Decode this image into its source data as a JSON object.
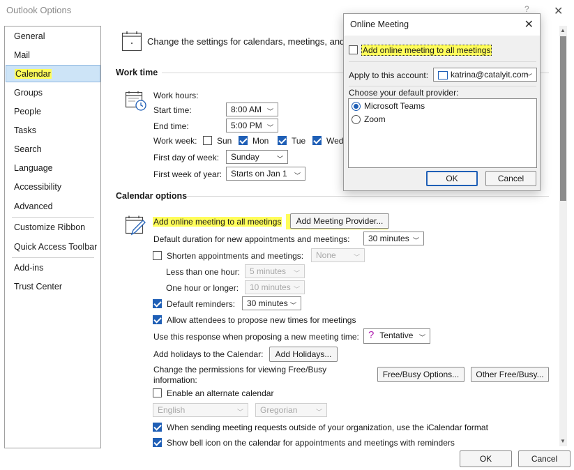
{
  "window": {
    "title": "Outlook Options",
    "help": "?",
    "close": "✕"
  },
  "sidebar": {
    "items": [
      {
        "label": "General"
      },
      {
        "label": "Mail"
      },
      {
        "label": "Calendar"
      },
      {
        "label": "Groups"
      },
      {
        "label": "People"
      },
      {
        "label": "Tasks"
      },
      {
        "label": "Search"
      },
      {
        "label": "Language"
      },
      {
        "label": "Accessibility"
      },
      {
        "label": "Advanced"
      },
      {
        "label": "Customize Ribbon"
      },
      {
        "label": "Quick Access Toolbar"
      },
      {
        "label": "Add-ins"
      },
      {
        "label": "Trust Center"
      }
    ],
    "selected": "Calendar"
  },
  "main": {
    "heading": "Change the settings for calendars, meetings, and",
    "work_time": {
      "title": "Work time",
      "hours_label": "Work hours:",
      "start_label": "Start time:",
      "start_value": "8:00 AM",
      "end_label": "End time:",
      "end_value": "5:00 PM",
      "week_label": "Work week:",
      "days": [
        {
          "label": "Sun",
          "checked": false
        },
        {
          "label": "Mon",
          "checked": true
        },
        {
          "label": "Tue",
          "checked": true
        },
        {
          "label": "Wed",
          "checked": true
        }
      ],
      "first_day_label": "First day of week:",
      "first_day_value": "Sunday",
      "first_week_label": "First week of year:",
      "first_week_value": "Starts on Jan 1"
    },
    "calendar_options": {
      "title": "Calendar options",
      "add_online_label": "Add online meeting to all meetings",
      "add_provider_button": "Add Meeting Provider...",
      "default_duration_label": "Default duration for new appointments and meetings:",
      "default_duration_value": "30 minutes",
      "shorten_label": "Shorten appointments and meetings:",
      "shorten_value": "None",
      "less_hour_label": "Less than one hour:",
      "less_hour_value": "5 minutes",
      "one_hour_label": "One hour or longer:",
      "one_hour_value": "10 minutes",
      "reminders_label": "Default reminders:",
      "reminders_value": "30 minutes",
      "propose_label": "Allow attendees to propose new times for meetings",
      "response_label": "Use this response when proposing a new meeting time:",
      "response_value": "Tentative",
      "holidays_label": "Add holidays to the Calendar:",
      "holidays_button": "Add Holidays...",
      "permissions_label_1": "Change the permissions for viewing Free/Busy",
      "permissions_label_2": "information:",
      "freebusy_button": "Free/Busy Options...",
      "other_freebusy_button": "Other Free/Busy...",
      "alternate_label": "Enable an alternate calendar",
      "alt_language_value": "English",
      "alt_calendar_value": "Gregorian",
      "icalendar_label": "When sending meeting requests outside of your organization, use the iCalendar format",
      "bell_label": "Show bell icon on the calendar for appointments and meetings with reminders"
    }
  },
  "footer": {
    "ok": "OK",
    "cancel": "Cancel"
  },
  "dialog": {
    "title": "Online Meeting",
    "add_online_label": "Add online meeting to all meetings",
    "apply_label": "Apply to this account:",
    "account_value": "katrina@catalyit.com",
    "provider_label": "Choose your default provider:",
    "providers": [
      {
        "label": "Microsoft Teams",
        "selected": true
      },
      {
        "label": "Zoom",
        "selected": false
      }
    ],
    "ok": "OK",
    "cancel": "Cancel"
  },
  "colors": {
    "highlight": "#fffd5a",
    "accent": "#1f5fb6",
    "selection": "#cde4f7"
  }
}
